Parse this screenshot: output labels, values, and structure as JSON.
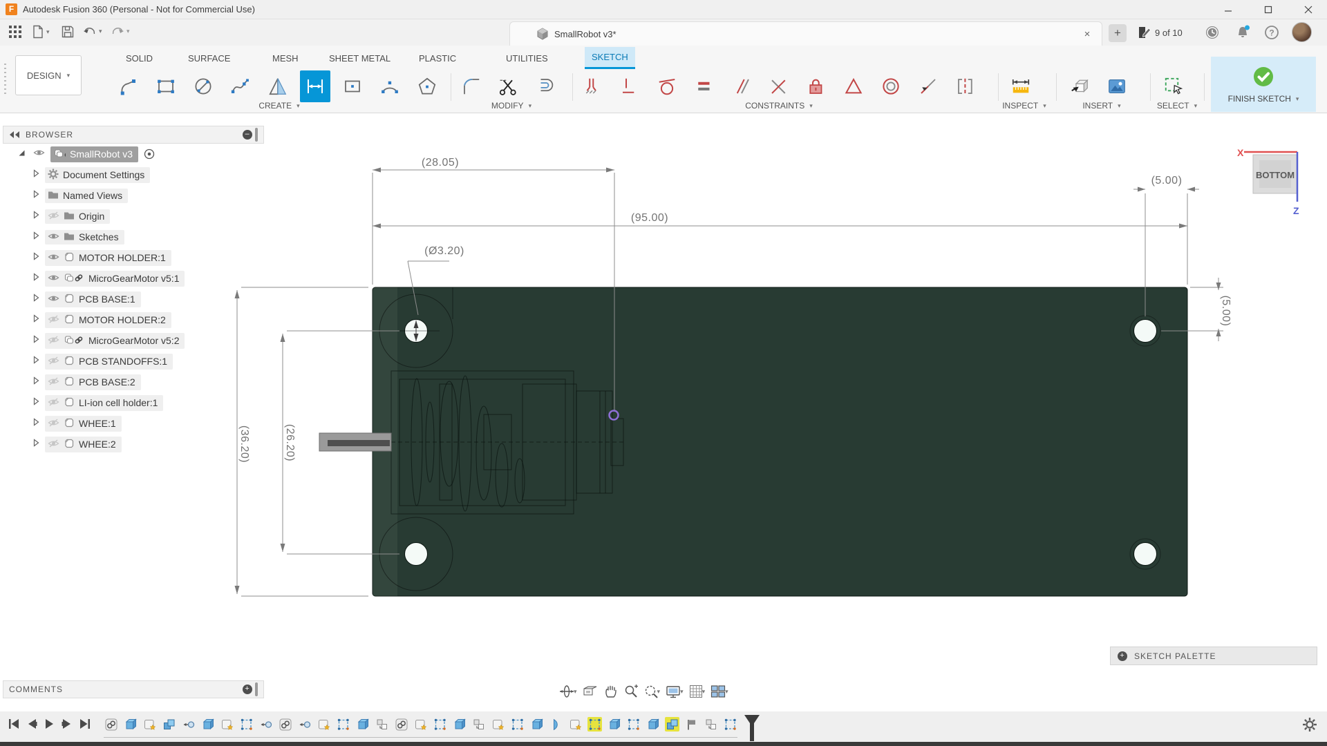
{
  "window": {
    "title": "Autodesk Fusion 360 (Personal - Not for Commercial Use)"
  },
  "header": {
    "document_tab": "SmallRobot v3*",
    "close_tab": "×",
    "new_tab": "+",
    "page_indicator": "9 of 10"
  },
  "ribbon": {
    "workspace": "DESIGN",
    "tabs": [
      "SOLID",
      "SURFACE",
      "MESH",
      "SHEET METAL",
      "PLASTIC",
      "UTILITIES",
      "SKETCH"
    ],
    "active_tab": "SKETCH",
    "groups": [
      "CREATE",
      "MODIFY",
      "CONSTRAINTS",
      "INSPECT",
      "INSERT",
      "SELECT"
    ],
    "finish_button": "FINISH SKETCH",
    "create_tools": [
      "line",
      "rectangle",
      "circle",
      "spline",
      "mirror",
      "dimension",
      "rectangle-center",
      "arc",
      "polygon"
    ],
    "active_tool": "dimension",
    "modify_tools": [
      "fillet",
      "trim",
      "offset"
    ],
    "constraint_tools": [
      "coincident",
      "vertical-horizontal",
      "tangent",
      "equal",
      "parallel",
      "perpendicular",
      "fix",
      "midpoint",
      "concentric",
      "curvature",
      "symmetry"
    ],
    "inspect_tools": [
      "measure"
    ],
    "insert_tools": [
      "insert-mesh",
      "image"
    ],
    "select_tools": [
      "select-window"
    ]
  },
  "browser": {
    "header": "BROWSER",
    "root": {
      "label": "SmallRobot v3"
    },
    "items": [
      {
        "label": "Document Settings",
        "icon": "gear",
        "eye": null
      },
      {
        "label": "Named Views",
        "icon": "folder",
        "eye": null
      },
      {
        "label": "Origin",
        "icon": "folder",
        "eye": "off"
      },
      {
        "label": "Sketches",
        "icon": "folder",
        "eye": "on"
      },
      {
        "label": "MOTOR HOLDER:1",
        "icon": "body",
        "eye": "on"
      },
      {
        "label": "MicroGearMotor v5:1",
        "icon": "linked",
        "eye": "on"
      },
      {
        "label": "PCB BASE:1",
        "icon": "body",
        "eye": "on"
      },
      {
        "label": "MOTOR HOLDER:2",
        "icon": "body",
        "eye": "off"
      },
      {
        "label": "MicroGearMotor v5:2",
        "icon": "linked",
        "eye": "off"
      },
      {
        "label": "PCB STANDOFFS:1",
        "icon": "body",
        "eye": "off"
      },
      {
        "label": "PCB BASE:2",
        "icon": "body",
        "eye": "off"
      },
      {
        "label": "LI-ion cell holder:1",
        "icon": "body",
        "eye": "off"
      },
      {
        "label": "WHEE:1",
        "icon": "body",
        "eye": "off"
      },
      {
        "label": "WHEE:2",
        "icon": "body",
        "eye": "off"
      }
    ]
  },
  "canvas": {
    "dimensions": {
      "top_left": "(28.05)",
      "total_width": "(95.00)",
      "top_right": "(5.00)",
      "hole_diameter": "(Ø3.20)",
      "total_height": "(36.20)",
      "hole_spacing": "(26.20)",
      "right_offset": "(5.00)"
    },
    "viewcube": {
      "face": "BOTTOM",
      "axis_x": "X",
      "axis_z": "Z"
    },
    "board_color": "#283b33",
    "point_color": "#8e6fd6"
  },
  "panels": {
    "sketch_palette": "SKETCH PALETTE",
    "comments": "COMMENTS"
  },
  "timeline": {
    "features": [
      "link",
      "extrude",
      "component",
      "combine",
      "joint",
      "extrude",
      "component",
      "sketch",
      "joint",
      "link",
      "joint",
      "component",
      "sketch",
      "extrude",
      "snapshot",
      "link",
      "component",
      "sketch",
      "extrude",
      "snapshot",
      "component",
      "sketch",
      "extrude",
      "revolve",
      "component",
      "sketch",
      "extrude",
      "sketch",
      "extrude",
      "combine",
      "flag",
      "snapshot",
      "sketch"
    ],
    "highlighted": [
      25,
      29
    ],
    "highlight_color": "#e6e33e"
  }
}
